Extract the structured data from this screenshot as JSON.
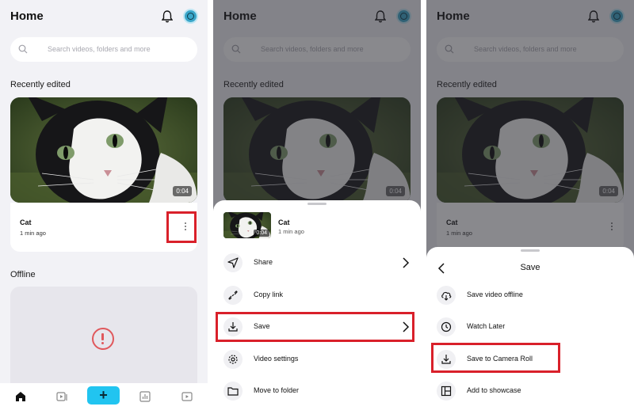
{
  "colors": {
    "highlight": "#d9202a",
    "accent": "#21c4f0",
    "alert": "#e0585c"
  },
  "home": {
    "title": "Home",
    "search_placeholder": "Search videos, folders and more",
    "recently_edited": "Recently edited",
    "video": {
      "name": "Cat",
      "time": "1 min ago",
      "duration": "0:04"
    },
    "offline": "Offline",
    "tabs": [
      "home-icon",
      "videos-icon",
      "create-icon",
      "analytics-icon",
      "showcase-icon"
    ],
    "create_label": "+"
  },
  "sheet_menu": {
    "video": {
      "name": "Cat",
      "time": "1 min ago",
      "duration": "0:04"
    },
    "items": [
      {
        "label": "Share",
        "icon": "share-icon"
      },
      {
        "label": "Copy link",
        "icon": "link-icon"
      },
      {
        "label": "Save",
        "icon": "download-icon"
      },
      {
        "label": "Video settings",
        "icon": "gear-icon"
      },
      {
        "label": "Move to folder",
        "icon": "folder-icon"
      }
    ]
  },
  "sheet_save": {
    "title": "Save",
    "items": [
      {
        "label": "Save video offline",
        "icon": "cloud-download-icon"
      },
      {
        "label": "Watch Later",
        "icon": "clock-icon"
      },
      {
        "label": "Save to Camera Roll",
        "icon": "download-icon"
      },
      {
        "label": "Add to showcase",
        "icon": "showcase-icon"
      }
    ]
  }
}
